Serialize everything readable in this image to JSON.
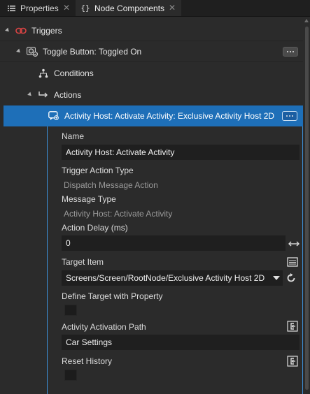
{
  "tabs": [
    {
      "label": "Properties",
      "icon": "list-icon",
      "active": false
    },
    {
      "label": "Node Components",
      "icon": "braces-icon",
      "active": true
    }
  ],
  "tree": {
    "triggers": {
      "label": "Triggers",
      "icon": "link-icon"
    },
    "toggle": {
      "label": "Toggle Button: Toggled On",
      "icon": "trigger-icon"
    },
    "conditions": {
      "label": "Conditions",
      "icon": "hierarchy-icon"
    },
    "actions": {
      "label": "Actions",
      "icon": "arrow-right-icon"
    },
    "activity": {
      "label": "Activity Host: Activate Activity: Exclusive Activity Host 2D",
      "icon": "message-icon"
    }
  },
  "properties": {
    "name": {
      "label": "Name",
      "value": "Activity Host: Activate Activity"
    },
    "trigger_action_type": {
      "label": "Trigger Action Type",
      "value": "Dispatch Message Action"
    },
    "message_type": {
      "label": "Message Type",
      "value": "Activity Host: Activate Activity"
    },
    "action_delay": {
      "label": "Action Delay (ms)",
      "value": "0"
    },
    "target_item": {
      "label": "Target Item",
      "value": "Screens/Screen/RootNode/Exclusive Activity Host 2D"
    },
    "define_target": {
      "label": "Define Target with Property",
      "checked": false
    },
    "activation_path": {
      "label": "Activity Activation Path",
      "value": "Car Settings"
    },
    "reset_history": {
      "label": "Reset History",
      "checked": false
    }
  },
  "colors": {
    "selection": "#1e6fb8",
    "panel_border": "#3d8fd6",
    "trigger_icon": "#d94444"
  }
}
